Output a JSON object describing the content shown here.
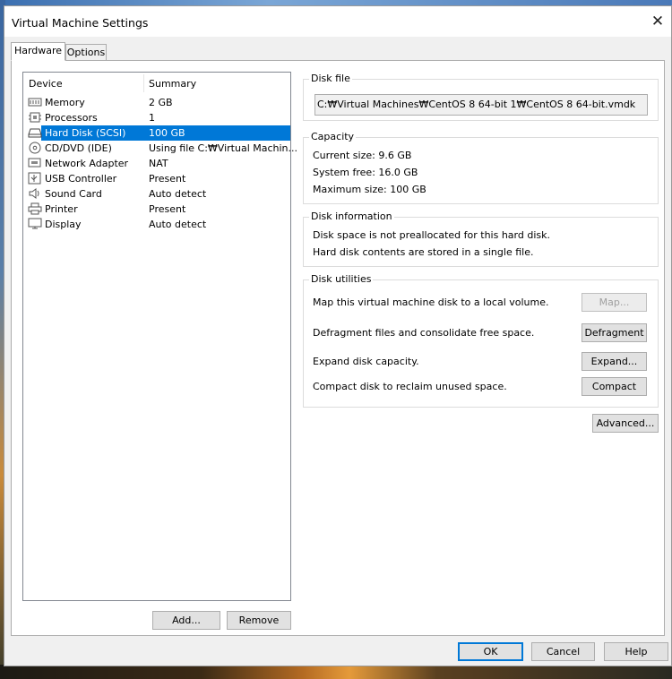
{
  "window": {
    "title": "Virtual Machine Settings"
  },
  "tabs": [
    {
      "label": "Hardware",
      "active": true
    },
    {
      "label": "Options",
      "active": false
    }
  ],
  "device_list": {
    "headers": [
      "Device",
      "Summary"
    ],
    "rows": [
      {
        "device": "Memory",
        "summary": "2 GB",
        "icon": "memory-icon"
      },
      {
        "device": "Processors",
        "summary": "1",
        "icon": "processor-icon"
      },
      {
        "device": "Hard Disk (SCSI)",
        "summary": "100 GB",
        "icon": "hard-disk-icon",
        "selected": true
      },
      {
        "device": "CD/DVD (IDE)",
        "summary": "Using file C:₩Virtual Machin...",
        "icon": "cd-dvd-icon"
      },
      {
        "device": "Network Adapter",
        "summary": "NAT",
        "icon": "network-adapter-icon"
      },
      {
        "device": "USB Controller",
        "summary": "Present",
        "icon": "usb-icon"
      },
      {
        "device": "Sound Card",
        "summary": "Auto detect",
        "icon": "sound-icon"
      },
      {
        "device": "Printer",
        "summary": "Present",
        "icon": "printer-icon"
      },
      {
        "device": "Display",
        "summary": "Auto detect",
        "icon": "display-icon"
      }
    ],
    "add_label": "Add...",
    "remove_label": "Remove"
  },
  "disk_file": {
    "legend": "Disk file",
    "path": "C:₩Virtual Machines₩CentOS 8 64-bit 1₩CentOS 8 64-bit.vmdk"
  },
  "capacity": {
    "legend": "Capacity",
    "current": "Current size:  9.6 GB",
    "system_free": "System free:  16.0 GB",
    "maximum": "Maximum size:  100 GB"
  },
  "disk_information": {
    "legend": "Disk information",
    "line1": "Disk space is not preallocated for this hard disk.",
    "line2": "Hard disk contents are stored in a single file."
  },
  "disk_utilities": {
    "legend": "Disk utilities",
    "map_text": "Map this virtual machine disk to a local volume.",
    "map_label": "Map...",
    "defrag_text": "Defragment files and consolidate free space.",
    "defrag_label": "Defragment",
    "expand_text": "Expand disk capacity.",
    "expand_label": "Expand...",
    "compact_text": "Compact disk to reclaim unused space.",
    "compact_label": "Compact"
  },
  "advanced_label": "Advanced...",
  "footer": {
    "ok": "OK",
    "cancel": "Cancel",
    "help": "Help"
  }
}
